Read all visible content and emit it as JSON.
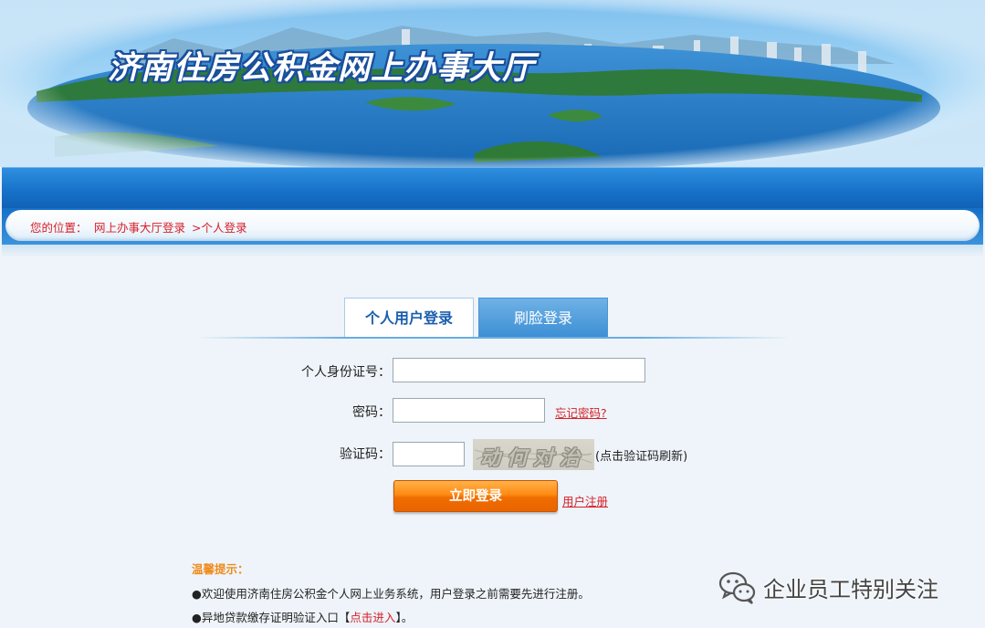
{
  "banner": {
    "title": "济南住房公积金网上办事大厅"
  },
  "breadcrumb": {
    "label": "您的位置：",
    "item1": "网上办事大厅登录",
    "item2": ">个人登录"
  },
  "tabs": [
    {
      "label": "个人用户登录",
      "active": true
    },
    {
      "label": "刷脸登录",
      "active": false
    }
  ],
  "form": {
    "id_label": "个人身份证号：",
    "id_value": "",
    "password_label": "密码：",
    "password_value": "",
    "forgot_link": "忘记密码?",
    "captcha_label": "验证码：",
    "captcha_value": "",
    "captcha_image_text": "动何对治",
    "captcha_hint": "(点击验证码刷新)",
    "login_button": "立即登录",
    "register_link": "用户注册"
  },
  "tips": {
    "title": "温馨提示：",
    "line1": "●欢迎使用济南住房公积金个人网上业务系统，用户登录之前需要先进行注册。",
    "line2_prefix": "●异地贷款缴存证明验证入口【",
    "line2_link": "点击进入",
    "line2_suffix": "】。"
  },
  "watermark": {
    "icon": "wechat-icon",
    "text": "企业员工特别关注"
  },
  "colors": {
    "accent_red": "#d8202a",
    "nav_blue": "#1670c8",
    "button_orange": "#ff8a12",
    "tip_orange": "#f08a1a"
  }
}
